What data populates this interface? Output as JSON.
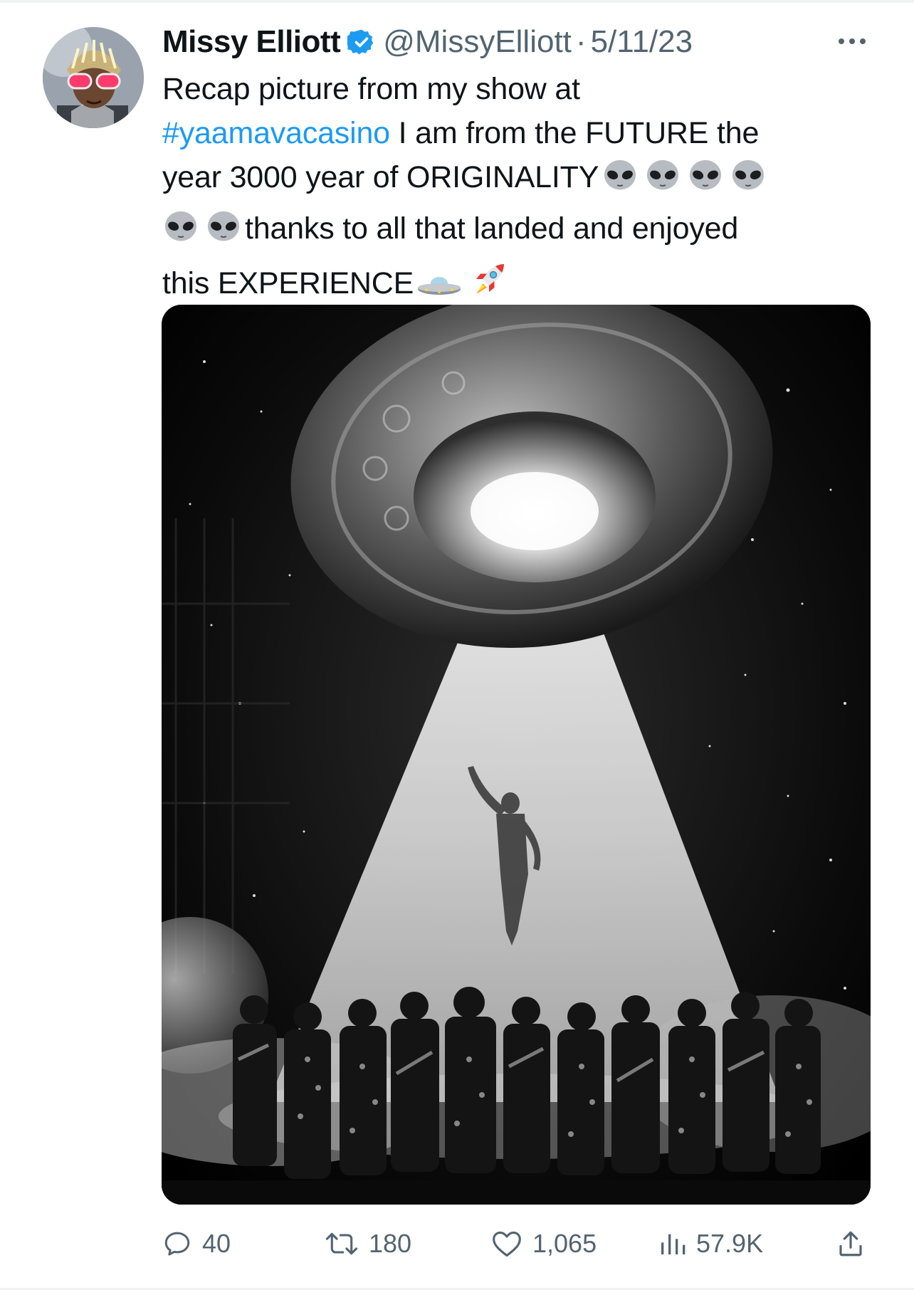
{
  "author": {
    "name": "Missy Elliott",
    "handle": "@MissyElliott",
    "separator": "·",
    "date": "5/11/23",
    "verified_color": "#1d9bf0"
  },
  "tweet": {
    "line1": "Recap picture from my show at",
    "hashtag": "#yaamavacasino",
    "line2_rest": " I am from the FUTURE the",
    "line3": "year 3000 year of ORIGINALITY",
    "line4": "thanks to all that landed and enjoyed",
    "line5": "this EXPERIENCE",
    "emojis": [
      "alien-emoji",
      "alien-emoji",
      "alien-emoji",
      "alien-emoji",
      "alien-emoji",
      "alien-emoji",
      "ufo-emoji",
      "rocket-emoji"
    ]
  },
  "media": {
    "description_icon": "ufo-beam-photo"
  },
  "actions": {
    "replies": "40",
    "retweets": "180",
    "likes": "1,065",
    "views": "57.9K"
  },
  "colors": {
    "text": "#0f1419",
    "secondary": "#536471",
    "link": "#1d9bf0"
  }
}
